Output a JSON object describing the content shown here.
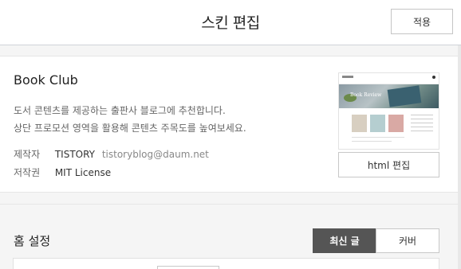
{
  "header": {
    "title": "스킨 편집",
    "apply_label": "적용"
  },
  "skin": {
    "name": "Book Club",
    "description_line1": "도서 콘텐츠를 제공하는 출판사 블로그에 추천합니다.",
    "description_line2": "상단 프로모션 영역을 활용해 콘텐츠 주목도를 높여보세요.",
    "maker_label": "제작자",
    "maker_name": "TISTORY",
    "maker_email": "tistoryblog@daum.net",
    "license_label": "저작권",
    "license_value": "MIT License",
    "thumbnail_caption": "Book Review",
    "html_edit_label": "html 편집"
  },
  "home": {
    "title": "홈 설정",
    "tabs": [
      {
        "label": "최신 글",
        "active": true
      },
      {
        "label": "커버",
        "active": false
      }
    ]
  }
}
